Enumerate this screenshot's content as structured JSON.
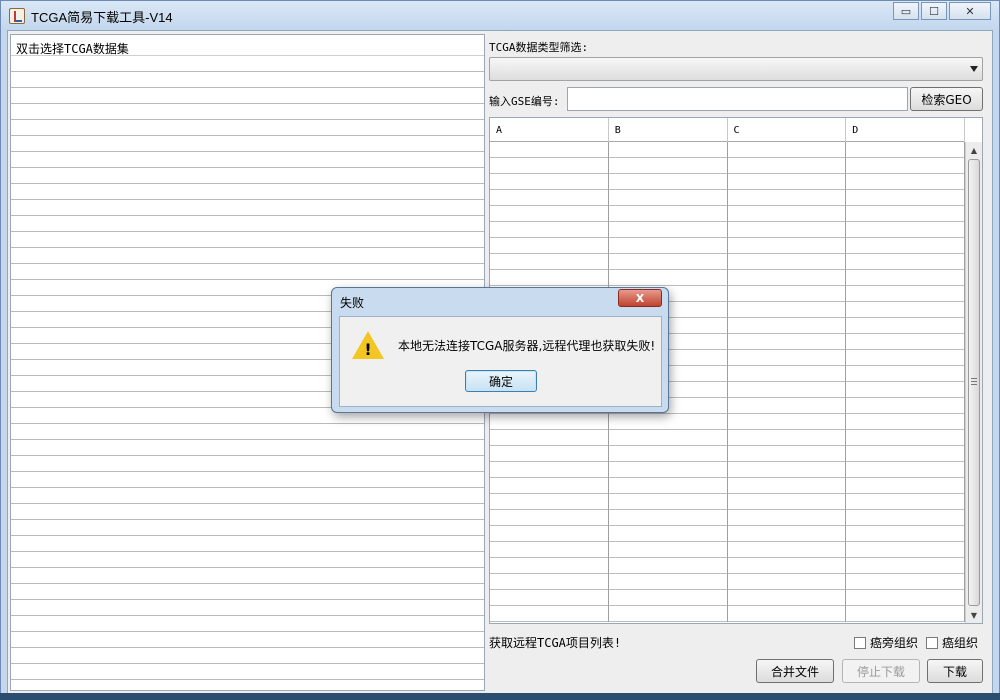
{
  "window": {
    "title": "TCGA简易下载工具-V14",
    "controls": {
      "minimize": "▭",
      "maximize": "☐",
      "close": "✕"
    }
  },
  "left_panel": {
    "header": "双击选择TCGA数据集",
    "row_count": 39
  },
  "filter": {
    "label": "TCGA数据类型筛选:",
    "selected": ""
  },
  "gse": {
    "label": "输入GSE编号:",
    "value": "",
    "search_button": "检索GEO"
  },
  "table": {
    "columns": [
      "A",
      "B",
      "C",
      "D"
    ],
    "row_count": 30
  },
  "status": {
    "text": "获取远程TCGA项目列表!"
  },
  "checkboxes": {
    "adjacent_tissue": {
      "label": "癌旁组织",
      "checked": false
    },
    "tumor_tissue": {
      "label": "癌组织",
      "checked": false
    }
  },
  "buttons": {
    "merge": "合并文件",
    "stop": "停止下载",
    "download": "下载"
  },
  "dialog": {
    "title": "失败",
    "close": "X",
    "message": "本地无法连接TCGA服务器,远程代理也获取失败!",
    "ok": "确定",
    "icon": "warning-icon"
  }
}
